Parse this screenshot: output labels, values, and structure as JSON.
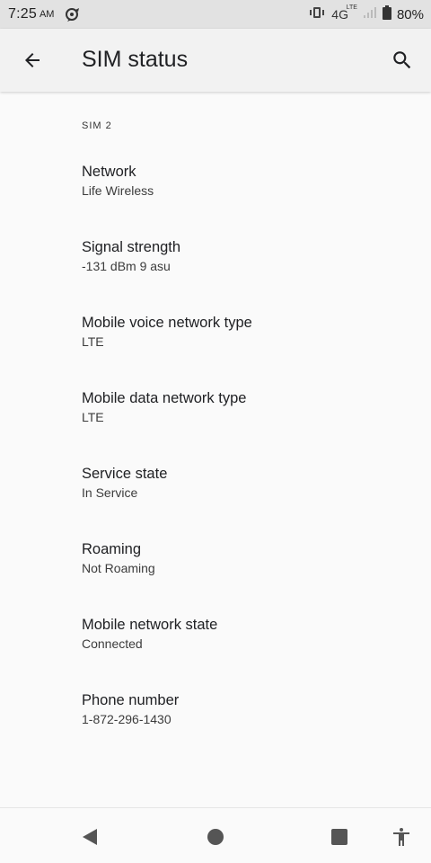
{
  "status_bar": {
    "time": "7:25",
    "ampm": "AM",
    "network": "4G",
    "network_sup": "LTE",
    "battery_pct": "80%",
    "icons": [
      "notification-icon",
      "vibrate-icon",
      "signal-icon",
      "battery-icon"
    ]
  },
  "app_bar": {
    "title": "SIM status",
    "icons": [
      "back-arrow-icon",
      "search-icon"
    ]
  },
  "section": {
    "header": "SIM 2"
  },
  "items": [
    {
      "title": "Network",
      "summary": "Life Wireless"
    },
    {
      "title": "Signal strength",
      "summary": "-131 dBm 9 asu"
    },
    {
      "title": "Mobile voice network type",
      "summary": "LTE"
    },
    {
      "title": "Mobile data network type",
      "summary": "LTE"
    },
    {
      "title": "Service state",
      "summary": "In Service"
    },
    {
      "title": "Roaming",
      "summary": "Not Roaming"
    },
    {
      "title": "Mobile network state",
      "summary": "Connected"
    },
    {
      "title": "Phone number",
      "summary": "1-872-296-1430"
    }
  ],
  "nav_bar": {
    "icons": [
      "back-triangle-icon",
      "home-circle-icon",
      "recents-square-icon",
      "accessibility-icon"
    ]
  },
  "colors": {
    "status_bar_bg": "#e2e2e2",
    "app_bar_bg": "#f2f2f2",
    "page_bg": "#fafafa",
    "text_primary": "#202124",
    "nav_icon": "#555555"
  }
}
